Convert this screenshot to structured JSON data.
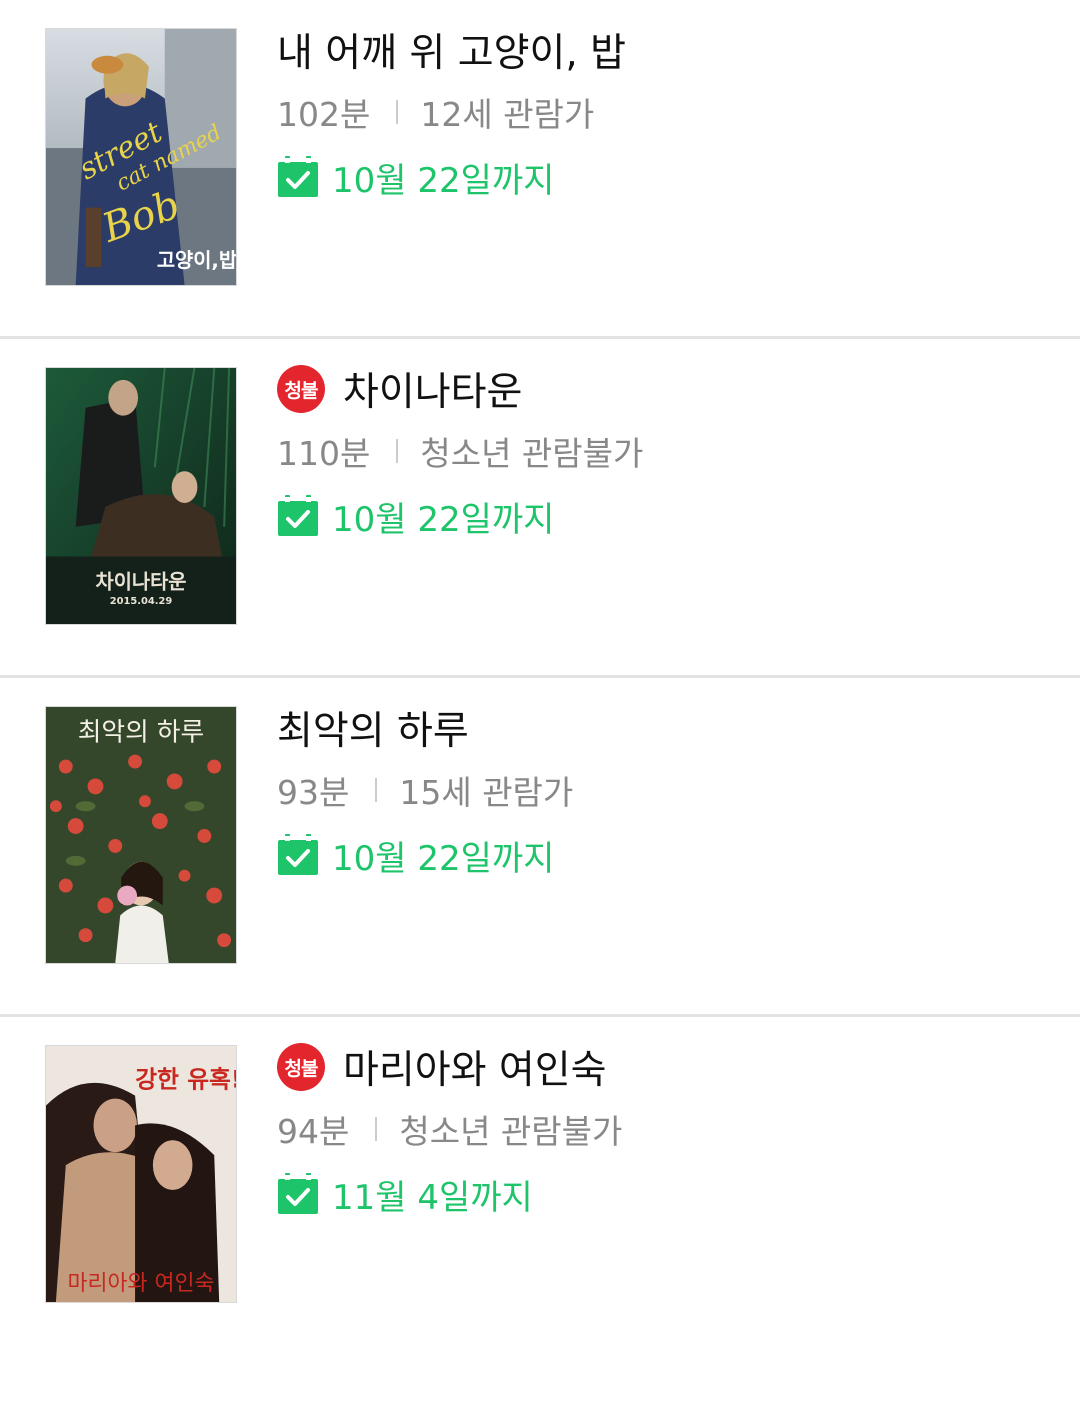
{
  "movies": [
    {
      "title": "내 어깨 위 고양이, 밥",
      "runtime": "102분",
      "rating": "12세 관람가",
      "until": "10월 22일까지",
      "adult_badge": "",
      "poster": {
        "text_en": "a street cat named Bob",
        "text_ko": "내 어깨 위 고양이, 밥",
        "colors": [
          "#6f7c88",
          "#2e3f6b",
          "#e8d34a"
        ]
      }
    },
    {
      "title": "차이나타운",
      "runtime": "110분",
      "rating": "청소년 관람불가",
      "until": "10월 22일까지",
      "adult_badge": "청불",
      "poster": {
        "text_ko": "차이나타운",
        "date": "2015.04.29",
        "colors": [
          "#163524",
          "#1f5b37",
          "#4d3a26"
        ]
      }
    },
    {
      "title": "최악의 하루",
      "runtime": "93분",
      "rating": "15세 관람가",
      "until": "10월 22일까지",
      "adult_badge": "",
      "poster": {
        "text_ko": "최악의 하루",
        "colors": [
          "#34472b",
          "#d64a3c",
          "#f1efe9"
        ]
      }
    },
    {
      "title": "마리아와 여인숙",
      "runtime": "94분",
      "rating": "청소년 관람불가",
      "until": "11월 4일까지",
      "adult_badge": "청불",
      "poster": {
        "text_ko": "강한 유혹!",
        "colors": [
          "#e8e2dc",
          "#b99478",
          "#2a1a16"
        ]
      }
    }
  ],
  "colors": {
    "accent_green": "#1ec46a",
    "badge_red": "#e3262e",
    "meta_gray": "#888888",
    "divider": "#e3e3e3"
  },
  "icons": {
    "calendar": "calendar-check-icon"
  }
}
